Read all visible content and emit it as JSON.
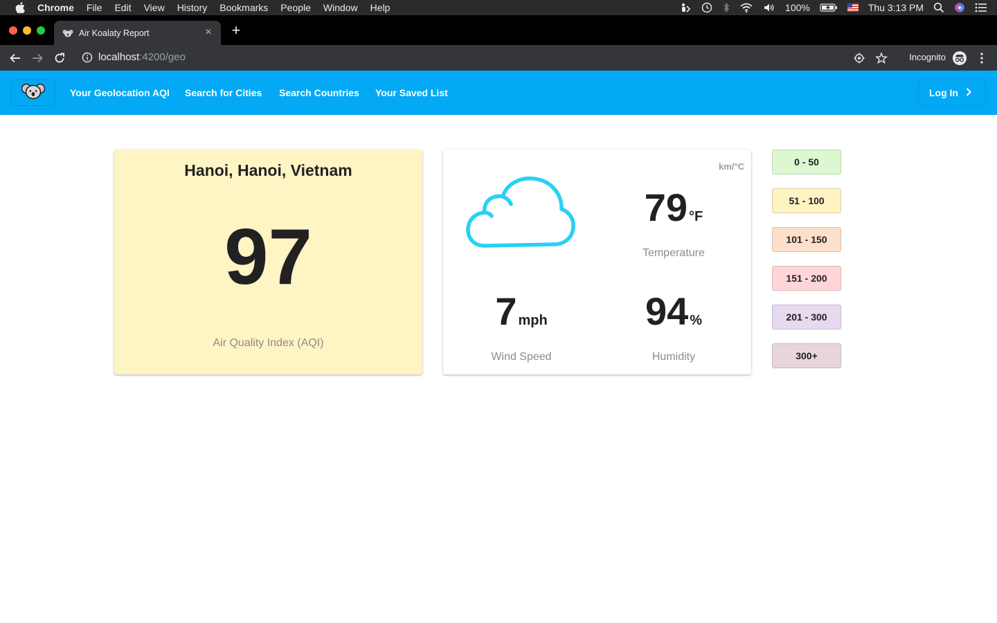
{
  "menubar": {
    "app_name": "Chrome",
    "items": [
      "File",
      "Edit",
      "View",
      "History",
      "Bookmarks",
      "People",
      "Window",
      "Help"
    ],
    "battery": "100%",
    "clock": "Thu 3:13 PM"
  },
  "browser": {
    "tab_title": "Air Koalaty Report",
    "url_host": "localhost",
    "url_path": ":4200/geo",
    "profile_label": "Incognito"
  },
  "nav": {
    "links": [
      "Your Geolocation AQI",
      "Search for Cities",
      "Search Countries",
      "Your Saved List"
    ],
    "login_label": "Log In"
  },
  "aqi_card": {
    "city": "Hanoi, Hanoi, Vietnam",
    "aqi": "97",
    "label": "Air Quality Index (AQI)",
    "background": "#fff4c4"
  },
  "weather_card": {
    "units_toggle": "km/°C",
    "icon": "cloud-icon",
    "temperature": {
      "value": "79",
      "unit": "°F",
      "label": "Temperature"
    },
    "wind": {
      "value": "7",
      "unit": "mph",
      "label": "Wind Speed"
    },
    "humidity": {
      "value": "94",
      "unit": "%",
      "label": "Humidity"
    }
  },
  "legend": [
    {
      "range": "0 - 50",
      "color": "#dcf8d1"
    },
    {
      "range": "51 - 100",
      "color": "#fdf3c3"
    },
    {
      "range": "101 - 150",
      "color": "#fde0cb"
    },
    {
      "range": "151 - 200",
      "color": "#fed6d8"
    },
    {
      "range": "201 - 300",
      "color": "#e6d9f0"
    },
    {
      "range": "300+",
      "color": "#e8d5dc"
    }
  ],
  "colors": {
    "navbar": "#03a9f4",
    "cloud": "#29d0f5"
  }
}
